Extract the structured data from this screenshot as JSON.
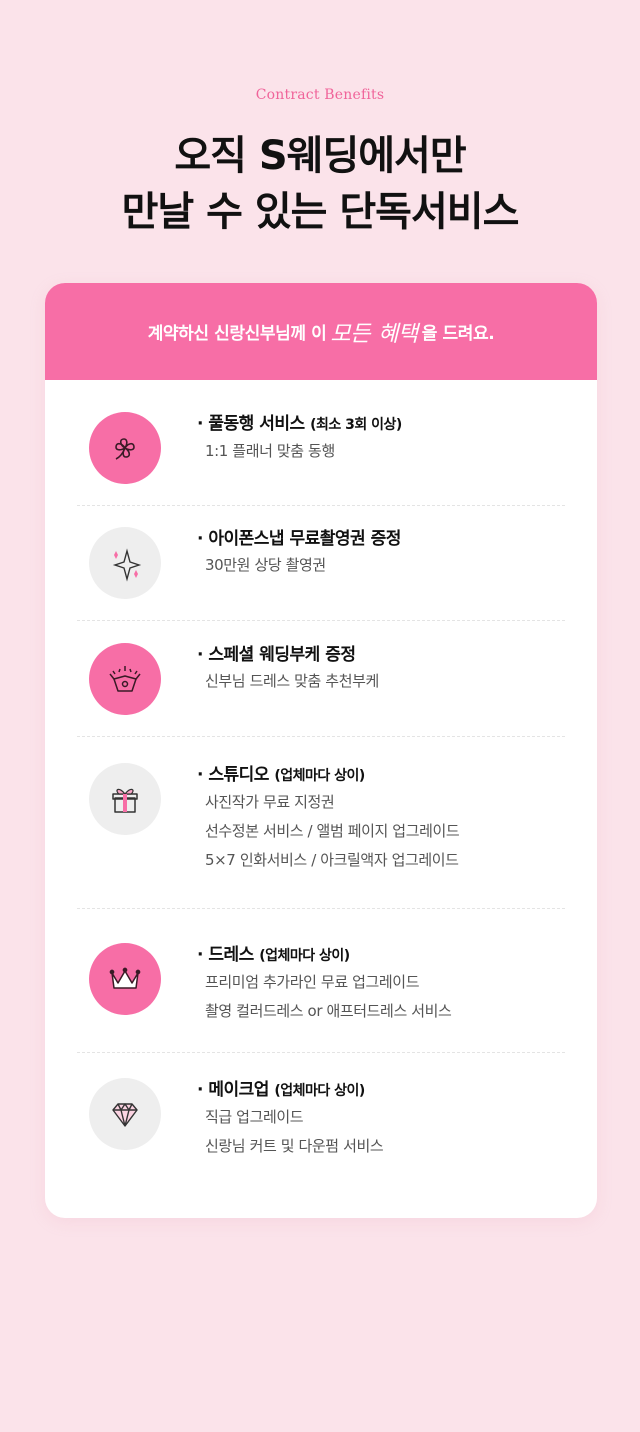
{
  "header": {
    "eyebrow": "Contract Benefits",
    "title_line1": "오직 S웨딩에서만",
    "title_line2": "만날 수 있는 단독서비스"
  },
  "banner": {
    "before": "계약하신 신랑신부님께 이",
    "script1": "모든",
    "script2": "혜택",
    "after": "을 드려요."
  },
  "benefits": [
    {
      "icon": "clover-icon",
      "title": "· 풀동행 서비스",
      "sub": "(최소 3회 이상)",
      "lines": [
        "1:1 플래너 맞춤 동행"
      ]
    },
    {
      "icon": "sparkle-icon",
      "title": "· 아이폰스냅 무료촬영권 증정",
      "sub": "",
      "lines": [
        "30만원 상당 촬영권"
      ]
    },
    {
      "icon": "bouquet-box-icon",
      "title": "· 스페셜 웨딩부케 증정",
      "sub": "",
      "lines": [
        "신부님 드레스 맞춤 추천부케"
      ]
    },
    {
      "icon": "gift-icon",
      "title": "· 스튜디오",
      "sub": "(업체마다 상이)",
      "lines": [
        "사진작가 무료 지정권",
        "선수정본 서비스 / 앨범 페이지 업그레이드",
        "5×7 인화서비스 / 아크릴액자 업그레이드"
      ]
    },
    {
      "icon": "crown-icon",
      "title": "· 드레스",
      "sub": "(업체마다 상이)",
      "lines": [
        "프리미엄 추가라인 무료 업그레이드",
        "촬영 컬러드레스 or 애프터드레스 서비스"
      ]
    },
    {
      "icon": "diamond-icon",
      "title": "· 메이크업",
      "sub": "(업체마다 상이)",
      "lines": [
        "직급 업그레이드",
        "신랑님 커트 및 다운펌 서비스"
      ]
    }
  ],
  "colors": {
    "accent": "#f76ea6",
    "background": "#fbe3ea",
    "icon_grey": "#eeeeee"
  }
}
